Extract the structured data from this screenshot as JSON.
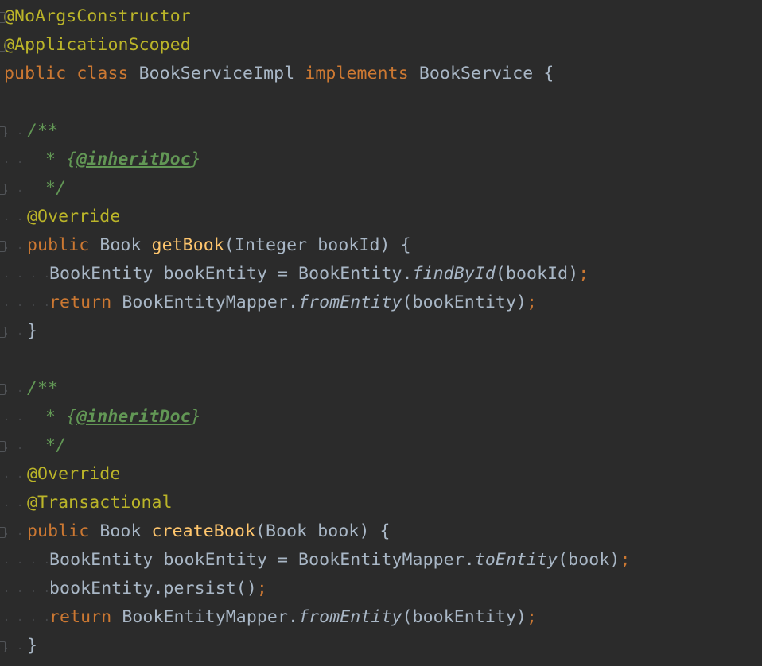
{
  "editor": {
    "lines": [
      {
        "tokens": [
          {
            "t": "@NoArgsConstructor",
            "c": "t-ann"
          }
        ]
      },
      {
        "tokens": [
          {
            "t": "@ApplicationScoped",
            "c": "t-ann"
          }
        ]
      },
      {
        "tokens": [
          {
            "t": "public",
            "c": "t-kw"
          },
          {
            "t": " ",
            "c": "t-id"
          },
          {
            "t": "class",
            "c": "t-kw"
          },
          {
            "t": " ",
            "c": "t-id"
          },
          {
            "t": "BookServiceImpl",
            "c": "t-id"
          },
          {
            "t": " ",
            "c": "t-id"
          },
          {
            "t": "implements",
            "c": "t-kw"
          },
          {
            "t": " ",
            "c": "t-id"
          },
          {
            "t": "BookService",
            "c": "t-id"
          },
          {
            "t": " {",
            "c": "t-id"
          }
        ]
      },
      {
        "tokens": []
      },
      {
        "tokens": [
          {
            "t": "/**",
            "c": "t-doc"
          }
        ]
      },
      {
        "tokens": [
          {
            "t": " * ",
            "c": "t-doc"
          },
          {
            "t": "{",
            "c": "t-docb"
          },
          {
            "t": "@inheritDoc",
            "c": "t-doctag"
          },
          {
            "t": "}",
            "c": "t-docb"
          }
        ]
      },
      {
        "tokens": [
          {
            "t": " */",
            "c": "t-doc"
          }
        ]
      },
      {
        "tokens": [
          {
            "t": "@Override",
            "c": "t-ann"
          }
        ]
      },
      {
        "tokens": [
          {
            "t": "public",
            "c": "t-kw"
          },
          {
            "t": " ",
            "c": "t-id"
          },
          {
            "t": "Book",
            "c": "t-id"
          },
          {
            "t": " ",
            "c": "t-id"
          },
          {
            "t": "getBook",
            "c": "t-fn"
          },
          {
            "t": "(Integer bookId) {",
            "c": "t-id"
          }
        ]
      },
      {
        "tokens": [
          {
            "t": "BookEntity bookEntity = BookEntity.",
            "c": "t-id"
          },
          {
            "t": "findById",
            "c": "t-it"
          },
          {
            "t": "(bookId)",
            "c": "t-id"
          },
          {
            "t": ";",
            "c": "t-semi"
          }
        ]
      },
      {
        "tokens": [
          {
            "t": "return",
            "c": "t-kw"
          },
          {
            "t": " ",
            "c": "t-id"
          },
          {
            "t": "BookEntityMapper.",
            "c": "t-id"
          },
          {
            "t": "fromEntity",
            "c": "t-it"
          },
          {
            "t": "(bookEntity)",
            "c": "t-id"
          },
          {
            "t": ";",
            "c": "t-semi"
          }
        ]
      },
      {
        "tokens": [
          {
            "t": "}",
            "c": "t-id"
          }
        ]
      },
      {
        "tokens": []
      },
      {
        "tokens": [
          {
            "t": "/**",
            "c": "t-doc"
          }
        ]
      },
      {
        "tokens": [
          {
            "t": " * ",
            "c": "t-doc"
          },
          {
            "t": "{",
            "c": "t-docb"
          },
          {
            "t": "@inheritDoc",
            "c": "t-doctag"
          },
          {
            "t": "}",
            "c": "t-docb"
          }
        ]
      },
      {
        "tokens": [
          {
            "t": " */",
            "c": "t-doc"
          }
        ]
      },
      {
        "tokens": [
          {
            "t": "@Override",
            "c": "t-ann"
          }
        ]
      },
      {
        "tokens": [
          {
            "t": "@Transactional",
            "c": "t-ann"
          }
        ]
      },
      {
        "tokens": [
          {
            "t": "public",
            "c": "t-kw"
          },
          {
            "t": " ",
            "c": "t-id"
          },
          {
            "t": "Book",
            "c": "t-id"
          },
          {
            "t": " ",
            "c": "t-id"
          },
          {
            "t": "createBook",
            "c": "t-fn"
          },
          {
            "t": "(Book book) {",
            "c": "t-id"
          }
        ]
      },
      {
        "tokens": [
          {
            "t": "BookEntity bookEntity = BookEntityMapper.",
            "c": "t-id"
          },
          {
            "t": "toEntity",
            "c": "t-it"
          },
          {
            "t": "(book)",
            "c": "t-id"
          },
          {
            "t": ";",
            "c": "t-semi"
          }
        ]
      },
      {
        "tokens": [
          {
            "t": "bookEntity.persist()",
            "c": "t-id"
          },
          {
            "t": ";",
            "c": "t-semi"
          }
        ]
      },
      {
        "tokens": [
          {
            "t": "return",
            "c": "t-kw"
          },
          {
            "t": " ",
            "c": "t-id"
          },
          {
            "t": "BookEntityMapper.",
            "c": "t-id"
          },
          {
            "t": "fromEntity",
            "c": "t-it"
          },
          {
            "t": "(bookEntity)",
            "c": "t-id"
          },
          {
            "t": ";",
            "c": "t-semi"
          }
        ]
      },
      {
        "tokens": [
          {
            "t": "}",
            "c": "t-id"
          }
        ]
      }
    ]
  }
}
